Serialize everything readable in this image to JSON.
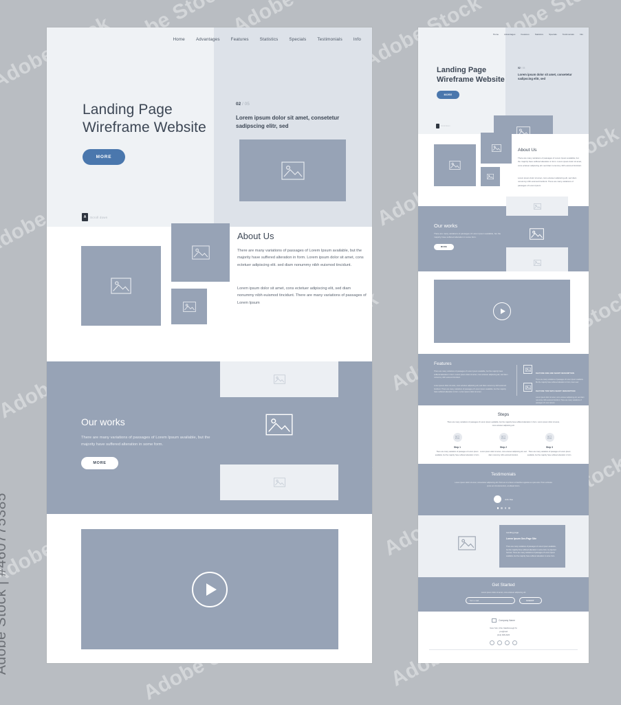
{
  "watermark": {
    "vertical": "Adobe Stock | #460775385",
    "tile": "Adobe Stock"
  },
  "colors": {
    "page_bg": "#b9bdc2",
    "slate": "#97a3b6",
    "accent_blue": "#4a77ad",
    "pale": "#eceff3",
    "ink": "#3c4654"
  },
  "nav": {
    "items": [
      "Home",
      "Advantages",
      "Features",
      "Statistics",
      "Specials",
      "Testimonials",
      "Info"
    ]
  },
  "hero": {
    "title_line1": "Landing Page",
    "title_line2": "Wireframe Website",
    "cta": "MORE",
    "counter_current": "02",
    "counter_total": "/ 05",
    "subtitle": "Lorem ipsum dolor sit amet, consetetur sadipscing elitr, sed",
    "badge_mark": "A",
    "badge_text": "Scroll down"
  },
  "about": {
    "heading": "About Us",
    "paragraph1": "There are many variations of passages of Lorem Ipsum available, but the majority have suffered alteration in form. Lorem ipsum dolor sit amet, cons ectetuer adipiscing elit.  sed diam nonummy nibh euismod tincidunt.",
    "paragraph2": "Lorem ipsum dolor sit amet, cons ectetuer adipiscing elit, sed diam nonummy nibh euismod tincidunt. There are many variations of passages of Lorem Ipsum"
  },
  "works": {
    "heading": "Our works",
    "paragraph": "There are many variations of passages of Lorem Ipsum available, but the majority have suffered alteration in some form.",
    "cta": "MORE"
  },
  "video": {
    "play_label": "play-button"
  },
  "features": {
    "heading": "Features",
    "paragraph1": "There are many variations of passages of Lorem Ipsum available, but the majority have suffered alteration in form.  Lorem ipsum dolor sit amet, cons ectetuer adipiscing elit, sed diam nonummy nibh euismod tincidunt.",
    "paragraph2": "Lorem ipsum dolor sit amet, cons ectetuer adipiscing elit, sed diam nonummy nibh euismod tincidunt. There are many variations of passages of Lorem Ipsum available, but the majority have suffered alteration in form. Lorem ipsum dolor sit amet.",
    "items": [
      {
        "title": "FEATURE ONE AND SHORT DESCRIPTION",
        "desc": "There are many variations of passages of Lorem Ipsum available. But the majority have suffered alteration in form, lorem sed."
      },
      {
        "title": "FEATURE TWO WITH SHORT DESCRIPTION",
        "desc": "Lorem ipsum dolor sit amet, cons ectetuer adipiscing elit, sed diam nonummy nibh euismod tincidunt. There are many variations of passages of Lorem Ipsum."
      }
    ]
  },
  "steps": {
    "heading": "Steps",
    "lead": "There are many variations of passages of Lorem Ipsum available, but the majority have suffered alteration in form. Lorem ipsum dolor sit amet, cons ectetuer adipiscing elit.",
    "items": [
      {
        "title": "Step 1",
        "desc": "There are many variations of passages of Lorem Ipsum available, but the majority have suffered alteration in form."
      },
      {
        "title": "Step 2",
        "desc": "Lorem ipsum dolor sit amet, cons ectetuer adipiscing elit, sed diam nonummy nibh euismod tincidunt."
      },
      {
        "title": "Step 3",
        "desc": "There are many variations of passages of Lorem Ipsum available, but the majority have suffered alteration in form."
      }
    ]
  },
  "testimonials": {
    "heading": "Testimonials",
    "quote": "Lorem ipsum dolor sit amet, consectetur adipiscing elit. Proin at mi ut ferco ut faucibus egestas eu quis ante. Proin vehicula purus ac nisl elementum, at aliquet lorem.",
    "author": "John Doe",
    "dots": 4,
    "active_dot": 1
  },
  "promo": {
    "label": "Landing page",
    "title": "Lorem Ipsum One-Page Site",
    "body": "There are many variations of passages of Lorem Ipsum available, but the majority have suffered alteration in some form, by injected humour. There are many variations of passages of Lorem Ipsum available, but the majority have suffered alteration in some form."
  },
  "cta": {
    "heading": "Get Started",
    "lead": "Lorem ipsum dolor sit amet, cons ectetuer adipiscing elit",
    "input_placeholder": "Your e-mail",
    "input_value": "",
    "button": "SUBMIT"
  },
  "footer": {
    "company": "Company Name",
    "address": "New York, USA, MacDonough St",
    "email": "you@mail",
    "phone": "(212) 998 2625",
    "social": [
      "facebook",
      "twitter",
      "instagram",
      "linkedin"
    ]
  }
}
